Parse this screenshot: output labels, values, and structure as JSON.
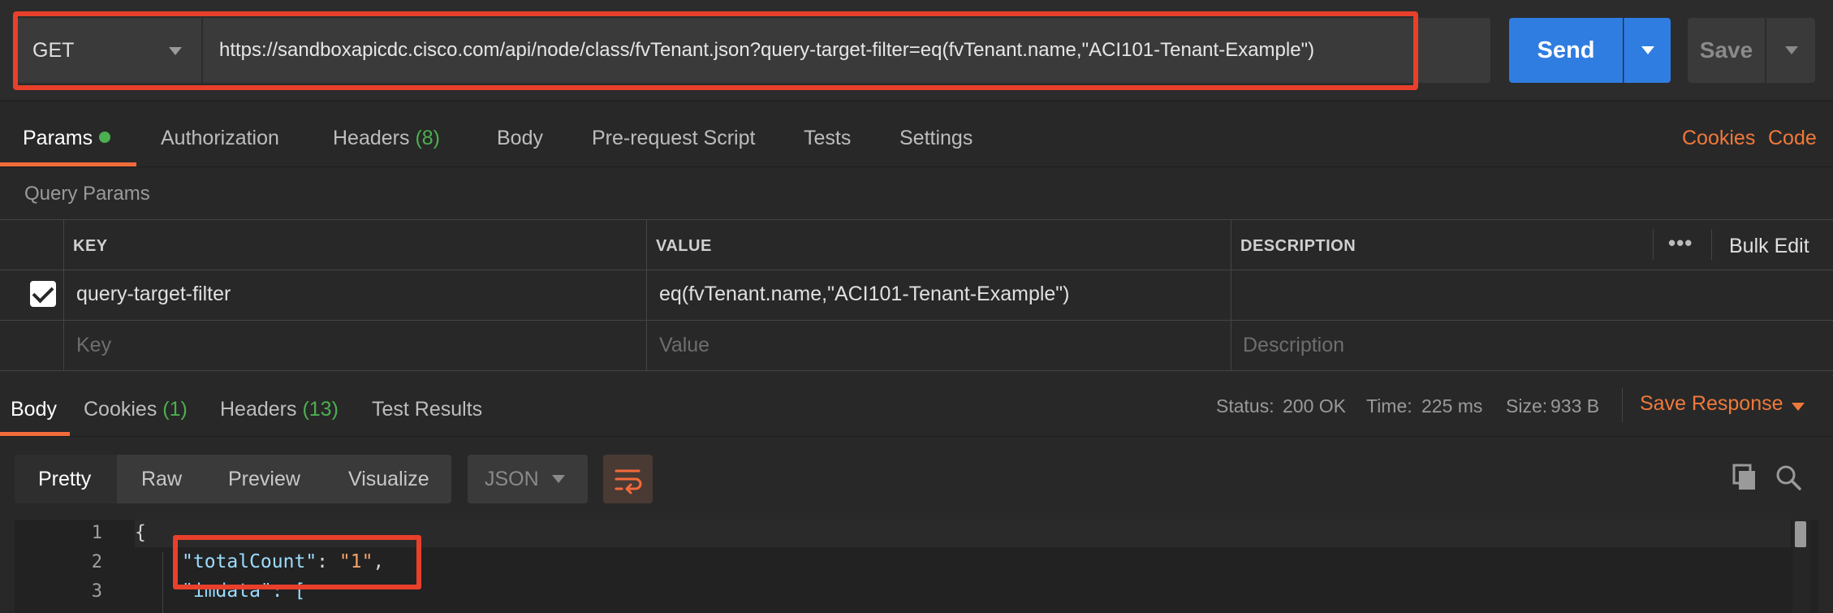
{
  "request": {
    "method": "GET",
    "url": "https://sandboxapicdc.cisco.com/api/node/class/fvTenant.json?query-target-filter=eq(fvTenant.name,\"ACI101-Tenant-Example\")",
    "send_label": "Send",
    "save_label": "Save"
  },
  "request_tabs": {
    "params": "Params",
    "authorization": "Authorization",
    "headers": "Headers",
    "headers_count": "(8)",
    "body": "Body",
    "prerequest": "Pre-request Script",
    "tests": "Tests",
    "settings": "Settings",
    "cookies": "Cookies",
    "code": "Code"
  },
  "query_params": {
    "title": "Query Params",
    "columns": {
      "key": "KEY",
      "value": "VALUE",
      "description": "DESCRIPTION"
    },
    "bulk_edit": "Bulk Edit",
    "row": {
      "key": "query-target-filter",
      "value": "eq(fvTenant.name,\"ACI101-Tenant-Example\")"
    },
    "placeholders": {
      "key": "Key",
      "value": "Value",
      "description": "Description"
    }
  },
  "response_tabs": {
    "body": "Body",
    "cookies": "Cookies",
    "cookies_count": "(1)",
    "headers": "Headers",
    "headers_count": "(13)",
    "test_results": "Test Results"
  },
  "response_meta": {
    "status_label": "Status:",
    "status_value": "200 OK",
    "time_label": "Time:",
    "time_value": "225 ms",
    "size_label": "Size:",
    "size_value": "933 B",
    "save_response": "Save Response"
  },
  "view": {
    "modes": [
      "Pretty",
      "Raw",
      "Preview",
      "Visualize"
    ],
    "format": "JSON"
  },
  "code": {
    "line_numbers": [
      "1",
      "2",
      "3"
    ],
    "line1": "{",
    "line2_key": "\"totalCount\"",
    "line2_sep": ": ",
    "line2_val": "\"1\"",
    "line2_end": ",",
    "line3": "\"imdata\": ["
  },
  "colors": {
    "accent": "#f26b3a",
    "send": "#2f7de1",
    "highlight": "#e8402b",
    "success": "#4caf50"
  }
}
